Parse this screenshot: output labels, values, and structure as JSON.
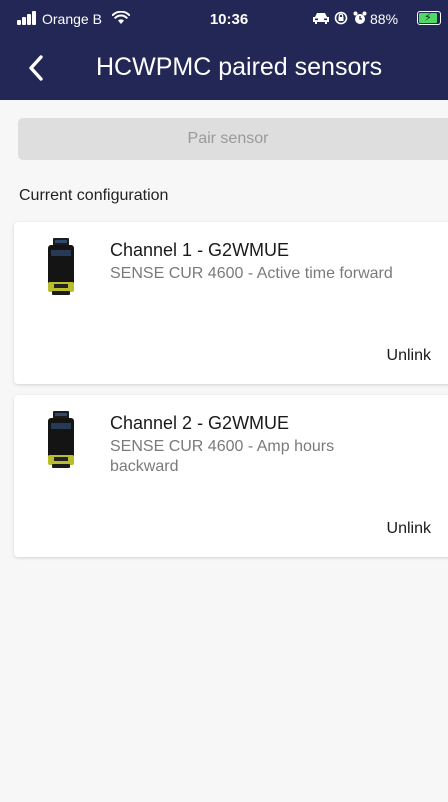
{
  "status_bar": {
    "carrier": "Orange B",
    "time": "10:36",
    "battery_percent": "88%"
  },
  "app_bar": {
    "title": "HCWPMC paired sensors",
    "back_icon": "chevron-left-icon"
  },
  "pair_button": {
    "label": "Pair sensor"
  },
  "section_label": "Current configuration",
  "sensors": [
    {
      "title": "Channel 1 - G2WMUE",
      "subtitle": "SENSE CUR 4600 - Active time forward",
      "unlink_label": "Unlink"
    },
    {
      "title": "Channel 2 - G2WMUE",
      "subtitle": "SENSE CUR 4600 - Amp hours backward",
      "unlink_label": "Unlink"
    }
  ],
  "colors": {
    "header_bg": "#222755",
    "page_bg": "#f7f7f7",
    "button_disabled_bg": "#dedede",
    "card_bg": "#ffffff",
    "battery_green": "#4cd964"
  }
}
